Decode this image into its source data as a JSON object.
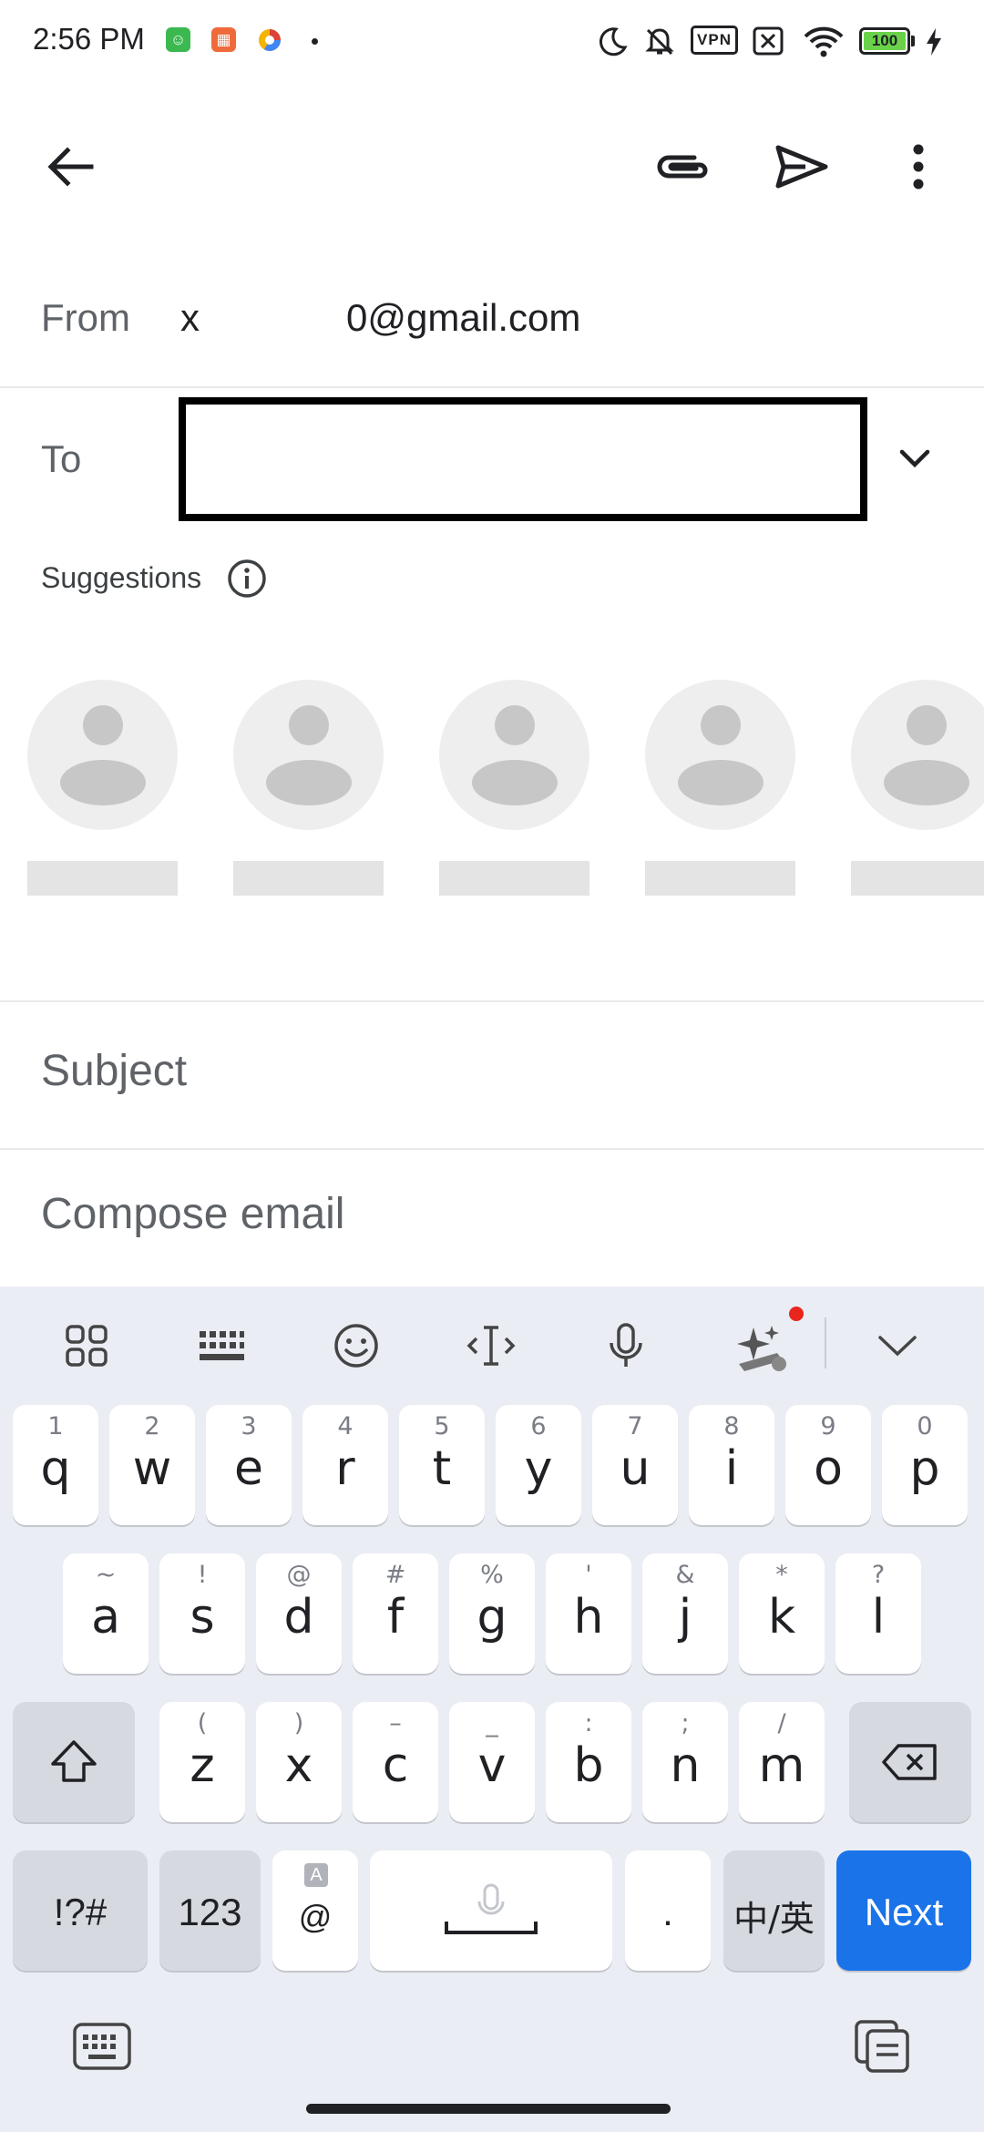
{
  "status_bar": {
    "time": "2:56 PM",
    "vpn": "VPN",
    "battery": "100"
  },
  "compose": {
    "from_label": "From",
    "from_prefix": "x",
    "from_email": "0@gmail.com",
    "to_label": "To",
    "to_value": "",
    "suggestions_label": "Suggestions",
    "subject_placeholder": "Subject",
    "body_placeholder": "Compose email"
  },
  "keyboard": {
    "row1": [
      {
        "main": "q",
        "sub": "1"
      },
      {
        "main": "w",
        "sub": "2"
      },
      {
        "main": "e",
        "sub": "3"
      },
      {
        "main": "r",
        "sub": "4"
      },
      {
        "main": "t",
        "sub": "5"
      },
      {
        "main": "y",
        "sub": "6"
      },
      {
        "main": "u",
        "sub": "7"
      },
      {
        "main": "i",
        "sub": "8"
      },
      {
        "main": "o",
        "sub": "9"
      },
      {
        "main": "p",
        "sub": "0"
      }
    ],
    "row2": [
      {
        "main": "a",
        "sub": "~"
      },
      {
        "main": "s",
        "sub": "!"
      },
      {
        "main": "d",
        "sub": "@"
      },
      {
        "main": "f",
        "sub": "#"
      },
      {
        "main": "g",
        "sub": "%"
      },
      {
        "main": "h",
        "sub": "'"
      },
      {
        "main": "j",
        "sub": "&"
      },
      {
        "main": "k",
        "sub": "*"
      },
      {
        "main": "l",
        "sub": "?"
      }
    ],
    "row3": [
      {
        "main": "z",
        "sub": "("
      },
      {
        "main": "x",
        "sub": ")"
      },
      {
        "main": "c",
        "sub": "–"
      },
      {
        "main": "v",
        "sub": "_"
      },
      {
        "main": "b",
        "sub": ":"
      },
      {
        "main": "n",
        "sub": ";"
      },
      {
        "main": "m",
        "sub": "/"
      }
    ],
    "symbols_label": "!?#",
    "numbers_label": "123",
    "at_label": "@",
    "at_sub": "A",
    "period_label": ".",
    "lang_label": "中/英",
    "next_label": "Next",
    "accent_color": "#1a73e8"
  }
}
